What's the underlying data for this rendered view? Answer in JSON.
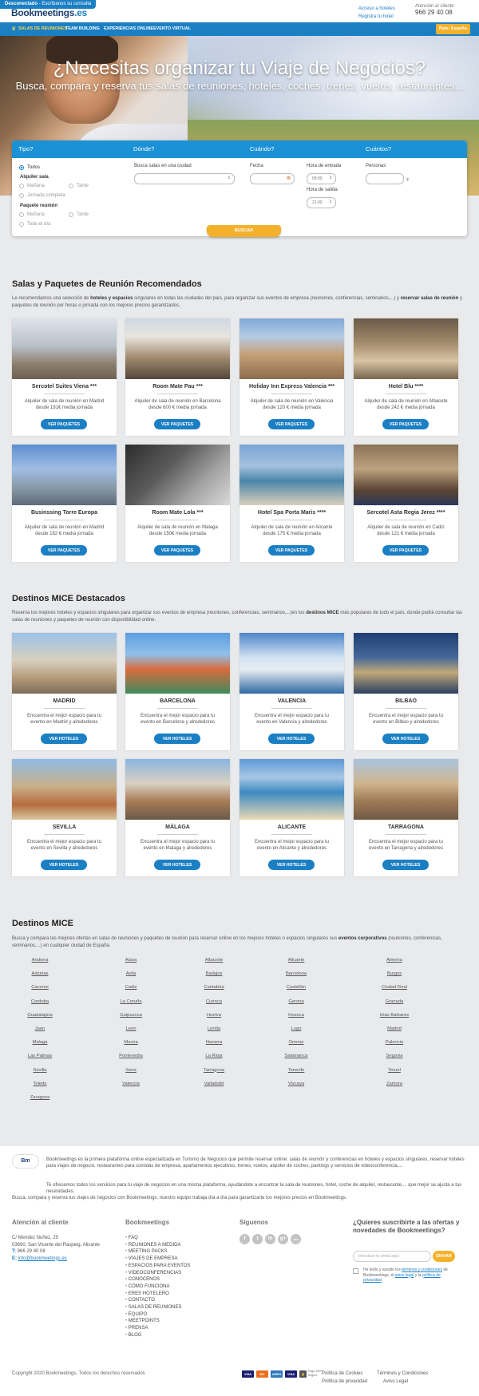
{
  "topbar": {
    "status_label": "Desconectado",
    "status_link": "- Escríbanos su consulta",
    "logo_main": "Bookmeetings",
    "logo_tld": ".es",
    "links": [
      "Acceso a hoteles",
      "Registra tu hotel"
    ],
    "attention_label": "Atención al cliente",
    "phone": "966 29 40 08"
  },
  "nav": {
    "items": [
      "SALAS DE REUNIONES",
      "TEAM BUILDING",
      "EXPERIENCIAS ONLINE",
      "EVENTO VIRTUAL"
    ],
    "country_button": "País: España"
  },
  "hero": {
    "title": "¿Necesitas organizar tu Viaje de Negocios?",
    "subtitle": "Busca, compara y reserva tus salas de reuniones, hoteles, coches, trenes, vuelos, restaurantes..."
  },
  "search": {
    "headers": [
      "Tipo?",
      "Dónde?",
      "Cuándo?",
      "Cuántos?"
    ],
    "tipo_todos": "Todos",
    "alquiler_label": "Alquiler sala",
    "manana": "Mañana",
    "tarde": "Tarde",
    "jornada": "Jornada completa",
    "paquete_label": "Paquete reunión",
    "todo_dia": "Todo el día",
    "donde_label": "Busca salas en una ciudad",
    "fecha_label": "Fecha",
    "hora_entrada_label": "Hora de entrada",
    "hora_entrada_value": "09:00",
    "hora_salida_label": "Hora de salida",
    "hora_salida_value": "21:00",
    "personas_label": "Personas",
    "button": "BUSCAR"
  },
  "recommended": {
    "title": "Salas y Paquetes de Reunión Recomendados",
    "desc_a": "Le recomendamos una selección de ",
    "desc_b": "hoteles y espacios",
    "desc_c": " singulares en todas las ciudades del país, para organizar sus eventos de empresa (reuniones, conferencias, seminarios,...) y ",
    "desc_d": "reservar salas de reunión",
    "desc_e": " y paquetes de reunión por horas o jornada con los mejores precios garantizados.",
    "button_label": "VER PAQUETES",
    "cards": [
      {
        "name": "Sercotel Suites Viena ***",
        "desc": "Alquiler de sala de reunión en Madrid desde 181€ media jornada"
      },
      {
        "name": "Room Mate Pau ***",
        "desc": "Alquiler de sala de reunión en Barcelona desde 600 € media jornada"
      },
      {
        "name": "Holiday Inn Express Valencia ***",
        "desc": "Alquiler de sala de reunión en Valencia desde 120 € media jornada"
      },
      {
        "name": "Hotel Blu ****",
        "desc": "Alquiler de sala de reunión en Albacete desde 242 € media jornada"
      },
      {
        "name": "Businssing Torre Europa",
        "desc": "Alquiler de sala de reunión en Madrid desde 182 € media jornada"
      },
      {
        "name": "Room Mate Lola ***",
        "desc": "Alquiler de sala de reunión en Malaga desde 150€ media jornada"
      },
      {
        "name": "Hotel Spa Porta Maris ****",
        "desc": "Alquiler de sala de reunión en Alicante desde 175 € media jornada"
      },
      {
        "name": "Sercotel Asta Regia Jerez ****",
        "desc": "Alquiler de sala de reunión en Cadiz desde 121 € media jornada"
      }
    ]
  },
  "destinations": {
    "title": "Destinos MICE Destacados",
    "desc_a": "Reserva los mejores hoteles y espacios singulares para organizar sus eventos de empresa (reuniones, conferencias, seminarios,...)en los ",
    "desc_b": "destinos MICE",
    "desc_c": " más populares de todo el país, donde podrá consultar las salas de reuniones y paquetes de reunión con disponibilidad online.",
    "button_label": "VER HOTELES",
    "cards": [
      {
        "name": "MADRID",
        "desc": "Encuentra el mejor espacio para tu evento en Madrid y alrededores"
      },
      {
        "name": "BARCELONA",
        "desc": "Encuentra el mejor espacio para tu evento en Barcelona y alrededores"
      },
      {
        "name": "VALENCIA",
        "desc": "Encuentra el mejor espacio para tu evento en Valencia y alrededores"
      },
      {
        "name": "BILBAO",
        "desc": "Encuentra el mejor espacio para tu evento en Bilbao y alrededores"
      },
      {
        "name": "SEVILLA",
        "desc": "Encuentra el mejor espacio para tu evento en Sevilla y alrededores"
      },
      {
        "name": "MÁLAGA",
        "desc": "Encuentra el mejor espacio para tu evento en Malaga y alrededores"
      },
      {
        "name": "ALICANTE",
        "desc": "Encuentra el mejor espacio para tu evento en Alicante y alrededores"
      },
      {
        "name": "TARRAGONA",
        "desc": "Encuentra el mejor espacio para tu evento en Tarragona y alrededores"
      }
    ]
  },
  "mice": {
    "title": "Destinos MICE",
    "desc_a": "Busca y compara las mejores ofertas en salas de reuniones y paquetes de reunión para reservar online en los mejores hoteles o espacios singulares sus ",
    "desc_b": "eventos corporativos",
    "desc_c": " (reuniones, conferencias, seminarios,...) en cualquier ciudad de España.",
    "cities": [
      "Andorra",
      "Alava",
      "Albacete",
      "Alicante",
      "Almeria",
      "Asturias",
      "Avila",
      "Badajoz",
      "Barcelona",
      "Burgos",
      "Caceres",
      "Cadiz",
      "Cantabria",
      "Castellón",
      "Ciudad Real",
      "Cordoba",
      "La Coruña",
      "Cuenca",
      "Gerona",
      "Granada",
      "Guadalajara",
      "Guipuzcoa",
      "Huelva",
      "Huesca",
      "Islas Baleares",
      "Jaen",
      "Leon",
      "Lerida",
      "Lugo",
      "Madrid",
      "Malaga",
      "Murcia",
      "Navarra",
      "Orense",
      "Palencia",
      "Las Palmas",
      "Pontevedra",
      "La Rioja",
      "Salamanca",
      "Segovia",
      "Sevilla",
      "Soria",
      "Tarragona",
      "Tenerife",
      "Teruel",
      "Toledo",
      "Valencia",
      "Valladolid",
      "Vizcaya",
      "Zamora",
      "Zaragoza"
    ]
  },
  "footer": {
    "logo_text": "Bm",
    "about_1": "Bookmeetings es la primera plataforma online especializada en Turismo de Negocios que permite reservar online: salas de reunión y conferencias en hoteles y espacios singulares, reservar hoteles para viajes de negocio, restaurantes para comidas de empresa, apartamentos ejecutivos, trenes, vuelos, alquiler de coches, parkings y servicios de videoconferencia,...",
    "about_2": "Te ofrecemos todos los servicios para tu viaje de negocios en una misma plataforma, ayudándote a encontrar la sala de reuniones, hotel, coche de alquiler, restaurante,... que mejor se ajusta a tus necesidades.",
    "about_3": "Busca, compara y reserva tus viajes de negocios con Bookmeetings, nuestro equipo trabaja día a día para garantizarte los mejores precios en Bookmeetings.",
    "attention_title": "Atención al cliente",
    "address_1": "C/ Mendez Nuñez, 25",
    "address_2": "03690, San Vicente del Raspeig, Alicante",
    "phone_label": "T:",
    "phone": "966 29 40 08",
    "email_label": "E:",
    "email": "info@bookmeetings.es",
    "menu_title": "Bookmeetings",
    "menu": [
      "FAQ",
      "REUNIONES A MEDIDA",
      "MEETING PACKS",
      "VIAJES DE EMPRESA",
      "ESPACIOS PARA EVENTOS",
      "VIDEOCONFERENCIAS",
      "CONÓCENOS",
      "CÓMO FUNCIONA",
      "ERES HOTELERO",
      "CONTACTO",
      "SALAS DE REUNIONES",
      "EQUIPO",
      "MEETPOINTS",
      "PRENSA",
      "BLOG"
    ],
    "follow_title": "Síguenos",
    "social": [
      "f",
      "t",
      "in",
      "g+",
      "rss"
    ],
    "newsletter_title": "¿Quieres suscribirte a las ofertas y novedades de Bookmeetings?",
    "newsletter_placeholder": "Introduce tu email aquí",
    "newsletter_button": "ENVIAR",
    "legal_a": "He leído y acepto los ",
    "legal_b": "términos y condiciones",
    "legal_c": " de Bookmeetings, el ",
    "legal_d": "aviso legal",
    "legal_e": " y la ",
    "legal_f": "política de privacidad",
    "legal_g": ".",
    "copyright": "Copyright 2020 Bookmeetings. Todos los derechos reservados",
    "payments": [
      "VISA",
      "MC",
      "AMEX",
      "VISA"
    ],
    "secure_label": "Pago 100% Seguro",
    "legal_links": [
      "Política de Cookies",
      "Términos y Condiciones",
      "Política de privacidad",
      "Aviso Legal"
    ]
  },
  "colors": {
    "brand_blue": "#1b7fc4",
    "accent_yellow": "#f3b12c",
    "nav_active": "#ffd84a"
  }
}
